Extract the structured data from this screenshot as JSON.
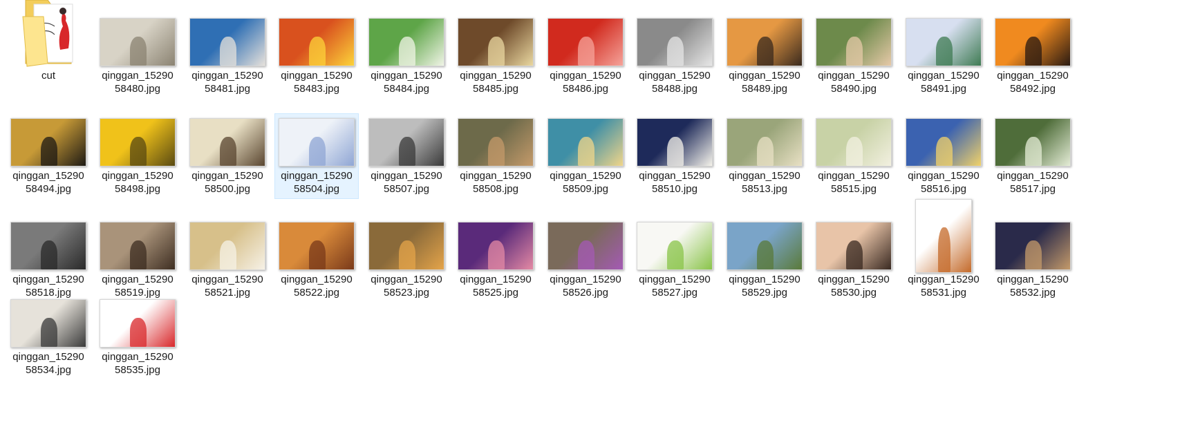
{
  "folder": {
    "name": "cut",
    "icon": "folder-icon",
    "colors": {
      "back": "#f3cd5b",
      "front": "#fde58f",
      "paper": "#ffffff",
      "accent": "#d8282b"
    }
  },
  "files": [
    {
      "name": "qinggan_1529058480.jpg",
      "line1": "qinggan_15290",
      "line2": "58480.jpg",
      "colors": [
        "#d8d3c6",
        "#8b8372"
      ],
      "selected": false
    },
    {
      "name": "qinggan_1529058481.jpg",
      "line1": "qinggan_15290",
      "line2": "58481.jpg",
      "colors": [
        "#2f6fb4",
        "#e6e1db"
      ],
      "selected": false
    },
    {
      "name": "qinggan_1529058483.jpg",
      "line1": "qinggan_15290",
      "line2": "58483.jpg",
      "colors": [
        "#d9511e",
        "#fcd33a"
      ],
      "selected": false
    },
    {
      "name": "qinggan_1529058484.jpg",
      "line1": "qinggan_15290",
      "line2": "58484.jpg",
      "colors": [
        "#5ea548",
        "#f0f4e6"
      ],
      "selected": false
    },
    {
      "name": "qinggan_1529058485.jpg",
      "line1": "qinggan_15290",
      "line2": "58485.jpg",
      "colors": [
        "#6e4a2a",
        "#e9d7a0"
      ],
      "selected": false
    },
    {
      "name": "qinggan_1529058486.jpg",
      "line1": "qinggan_15290",
      "line2": "58486.jpg",
      "colors": [
        "#d12a1e",
        "#f5a39a"
      ],
      "selected": false
    },
    {
      "name": "qinggan_1529058488.jpg",
      "line1": "qinggan_15290",
      "line2": "58488.jpg",
      "colors": [
        "#8a8a8a",
        "#e6e6e6"
      ],
      "selected": false
    },
    {
      "name": "qinggan_1529058489.jpg",
      "line1": "qinggan_15290",
      "line2": "58489.jpg",
      "colors": [
        "#e59843",
        "#3a2a1e"
      ],
      "selected": false
    },
    {
      "name": "qinggan_1529058490.jpg",
      "line1": "qinggan_15290",
      "line2": "58490.jpg",
      "colors": [
        "#6d8a4b",
        "#e6c9a8"
      ],
      "selected": false
    },
    {
      "name": "qinggan_1529058491.jpg",
      "line1": "qinggan_15290",
      "line2": "58491.jpg",
      "colors": [
        "#d7dff0",
        "#3f7b53"
      ],
      "selected": false
    },
    {
      "name": "qinggan_1529058492.jpg",
      "line1": "qinggan_15290",
      "line2": "58492.jpg",
      "colors": [
        "#f08a1f",
        "#2a1a12"
      ],
      "selected": false
    },
    {
      "name": "qinggan_1529058494.jpg",
      "line1": "qinggan_15290",
      "line2": "58494.jpg",
      "colors": [
        "#c79a37",
        "#1e1a14"
      ],
      "selected": false
    },
    {
      "name": "qinggan_1529058498.jpg",
      "line1": "qinggan_15290",
      "line2": "58498.jpg",
      "colors": [
        "#f0c21a",
        "#5a4a12"
      ],
      "selected": false
    },
    {
      "name": "qinggan_1529058500.jpg",
      "line1": "qinggan_15290",
      "line2": "58500.jpg",
      "colors": [
        "#e8dfc4",
        "#5a4630"
      ],
      "selected": false
    },
    {
      "name": "qinggan_1529058504.jpg",
      "line1": "qinggan_15290",
      "line2": "58504.jpg",
      "colors": [
        "#eef2f8",
        "#8fa6d4"
      ],
      "selected": true
    },
    {
      "name": "qinggan_1529058507.jpg",
      "line1": "qinggan_15290",
      "line2": "58507.jpg",
      "colors": [
        "#bdbdbd",
        "#3a3a3a"
      ],
      "selected": false
    },
    {
      "name": "qinggan_1529058508.jpg",
      "line1": "qinggan_15290",
      "line2": "58508.jpg",
      "colors": [
        "#6d6a4a",
        "#c49a6a"
      ],
      "selected": false
    },
    {
      "name": "qinggan_1529058509.jpg",
      "line1": "qinggan_15290",
      "line2": "58509.jpg",
      "colors": [
        "#3f8fa6",
        "#f0d58a"
      ],
      "selected": false
    },
    {
      "name": "qinggan_1529058510.jpg",
      "line1": "qinggan_15290",
      "line2": "58510.jpg",
      "colors": [
        "#1e2a5a",
        "#f4f2ea"
      ],
      "selected": false
    },
    {
      "name": "qinggan_1529058513.jpg",
      "line1": "qinggan_15290",
      "line2": "58513.jpg",
      "colors": [
        "#9aa57a",
        "#e8e0c4"
      ],
      "selected": false
    },
    {
      "name": "qinggan_1529058515.jpg",
      "line1": "qinggan_15290",
      "line2": "58515.jpg",
      "colors": [
        "#c8d2a6",
        "#f2f0e0"
      ],
      "selected": false
    },
    {
      "name": "qinggan_1529058516.jpg",
      "line1": "qinggan_15290",
      "line2": "58516.jpg",
      "colors": [
        "#3b62b0",
        "#f1d26a"
      ],
      "selected": false
    },
    {
      "name": "qinggan_1529058517.jpg",
      "line1": "qinggan_15290",
      "line2": "58517.jpg",
      "colors": [
        "#4f6d3a",
        "#e4ecd6"
      ],
      "selected": false
    },
    {
      "name": "qinggan_1529058518.jpg",
      "line1": "qinggan_15290",
      "line2": "58518.jpg",
      "colors": [
        "#7a7a7a",
        "#2a2a2a"
      ],
      "selected": false
    },
    {
      "name": "qinggan_1529058519.jpg",
      "line1": "qinggan_15290",
      "line2": "58519.jpg",
      "colors": [
        "#a9937a",
        "#3e2e22"
      ],
      "selected": false
    },
    {
      "name": "qinggan_1529058521.jpg",
      "line1": "qinggan_15290",
      "line2": "58521.jpg",
      "colors": [
        "#d7c08a",
        "#f6f1e6"
      ],
      "selected": false
    },
    {
      "name": "qinggan_1529058522.jpg",
      "line1": "qinggan_15290",
      "line2": "58522.jpg",
      "colors": [
        "#d98a3a",
        "#7a3a1a"
      ],
      "selected": false
    },
    {
      "name": "qinggan_1529058523.jpg",
      "line1": "qinggan_15290",
      "line2": "58523.jpg",
      "colors": [
        "#8a6a3a",
        "#e4a44a"
      ],
      "selected": false
    },
    {
      "name": "qinggan_1529058525.jpg",
      "line1": "qinggan_15290",
      "line2": "58525.jpg",
      "colors": [
        "#5a2a7a",
        "#e48aa4"
      ],
      "selected": false
    },
    {
      "name": "qinggan_1529058526.jpg",
      "line1": "qinggan_15290",
      "line2": "58526.jpg",
      "colors": [
        "#7a6a5a",
        "#a45ab4"
      ],
      "selected": false
    },
    {
      "name": "qinggan_1529058527.jpg",
      "line1": "qinggan_15290",
      "line2": "58527.jpg",
      "colors": [
        "#f8f8f4",
        "#8ac44a"
      ],
      "selected": false
    },
    {
      "name": "qinggan_1529058529.jpg",
      "line1": "qinggan_15290",
      "line2": "58529.jpg",
      "colors": [
        "#7aa4c8",
        "#5a7a3a"
      ],
      "selected": false
    },
    {
      "name": "qinggan_1529058530.jpg",
      "line1": "qinggan_15290",
      "line2": "58530.jpg",
      "colors": [
        "#e8c4a8",
        "#3a2a22"
      ],
      "selected": false
    },
    {
      "name": "qinggan_1529058531.jpg",
      "line1": "qinggan_15290",
      "line2": "58531.jpg",
      "colors": [
        "#ffffff",
        "#c46a2a"
      ],
      "selected": false,
      "tall": true
    },
    {
      "name": "qinggan_1529058532.jpg",
      "line1": "qinggan_15290",
      "line2": "58532.jpg",
      "colors": [
        "#2a2a4a",
        "#c49a6a"
      ],
      "selected": false
    },
    {
      "name": "qinggan_1529058534.jpg",
      "line1": "qinggan_15290",
      "line2": "58534.jpg",
      "colors": [
        "#e6e2da",
        "#3a3a3a"
      ],
      "selected": false
    },
    {
      "name": "qinggan_1529058535.jpg",
      "line1": "qinggan_15290",
      "line2": "58535.jpg",
      "colors": [
        "#ffffff",
        "#d8282b"
      ],
      "selected": false
    }
  ]
}
